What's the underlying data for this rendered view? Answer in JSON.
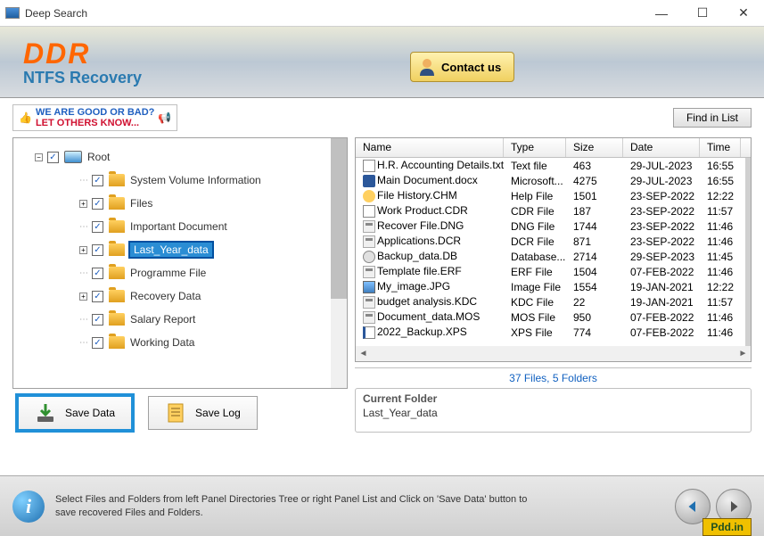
{
  "window": {
    "title": "Deep Search"
  },
  "header": {
    "logo_text": "DDR",
    "logo_sub": "NTFS Recovery",
    "contact_label": "Contact us"
  },
  "toolbar": {
    "feedback_line1": "WE ARE GOOD OR BAD?",
    "feedback_line2": "LET OTHERS KNOW...",
    "find_label": "Find in List"
  },
  "tree": {
    "root": "Root",
    "items": [
      {
        "label": "System Volume Information",
        "expand": null
      },
      {
        "label": "Files",
        "expand": "+"
      },
      {
        "label": "Important Document",
        "expand": null
      },
      {
        "label": "Last_Year_data",
        "expand": "+",
        "selected": true
      },
      {
        "label": "Programme File",
        "expand": null
      },
      {
        "label": "Recovery Data",
        "expand": "+"
      },
      {
        "label": "Salary Report",
        "expand": null
      },
      {
        "label": "Working Data",
        "expand": null
      }
    ]
  },
  "actions": {
    "save_data": "Save Data",
    "save_log": "Save Log"
  },
  "list": {
    "headers": {
      "name": "Name",
      "type": "Type",
      "size": "Size",
      "date": "Date",
      "time": "Time"
    },
    "rows": [
      {
        "name": "H.R. Accounting Details.txt",
        "type": "Text file",
        "size": "463",
        "date": "29-JUL-2023",
        "time": "16:55",
        "icon": "txt"
      },
      {
        "name": "Main Document.docx",
        "type": "Microsoft...",
        "size": "4275",
        "date": "29-JUL-2023",
        "time": "16:55",
        "icon": "docx"
      },
      {
        "name": "File History.CHM",
        "type": "Help File",
        "size": "1501",
        "date": "23-SEP-2022",
        "time": "12:22",
        "icon": "chm"
      },
      {
        "name": "Work Product.CDR",
        "type": "CDR File",
        "size": "187",
        "date": "23-SEP-2022",
        "time": "11:57",
        "icon": "cdr"
      },
      {
        "name": "Recover File.DNG",
        "type": "DNG File",
        "size": "1744",
        "date": "23-SEP-2022",
        "time": "11:46",
        "icon": "generic"
      },
      {
        "name": "Applications.DCR",
        "type": "DCR File",
        "size": "871",
        "date": "23-SEP-2022",
        "time": "11:46",
        "icon": "generic"
      },
      {
        "name": "Backup_data.DB",
        "type": "Database...",
        "size": "2714",
        "date": "29-SEP-2023",
        "time": "11:45",
        "icon": "db"
      },
      {
        "name": "Template file.ERF",
        "type": "ERF File",
        "size": "1504",
        "date": "07-FEB-2022",
        "time": "11:46",
        "icon": "generic"
      },
      {
        "name": "My_image.JPG",
        "type": "Image File",
        "size": "1554",
        "date": "19-JAN-2021",
        "time": "12:22",
        "icon": "jpg"
      },
      {
        "name": "budget analysis.KDC",
        "type": "KDC File",
        "size": "22",
        "date": "19-JAN-2021",
        "time": "11:57",
        "icon": "generic"
      },
      {
        "name": "Document_data.MOS",
        "type": "MOS File",
        "size": "950",
        "date": "07-FEB-2022",
        "time": "11:46",
        "icon": "generic"
      },
      {
        "name": "2022_Backup.XPS",
        "type": "XPS File",
        "size": "774",
        "date": "07-FEB-2022",
        "time": "11:46",
        "icon": "xps"
      }
    ],
    "summary": "37 Files, 5 Folders",
    "current_folder_label": "Current Folder",
    "current_folder_name": "Last_Year_data"
  },
  "footer": {
    "text": "Select Files and Folders from left Panel Directories Tree or right Panel List and Click on 'Save Data' button to save recovered Files and Folders.",
    "brand": "Pdd.in"
  }
}
